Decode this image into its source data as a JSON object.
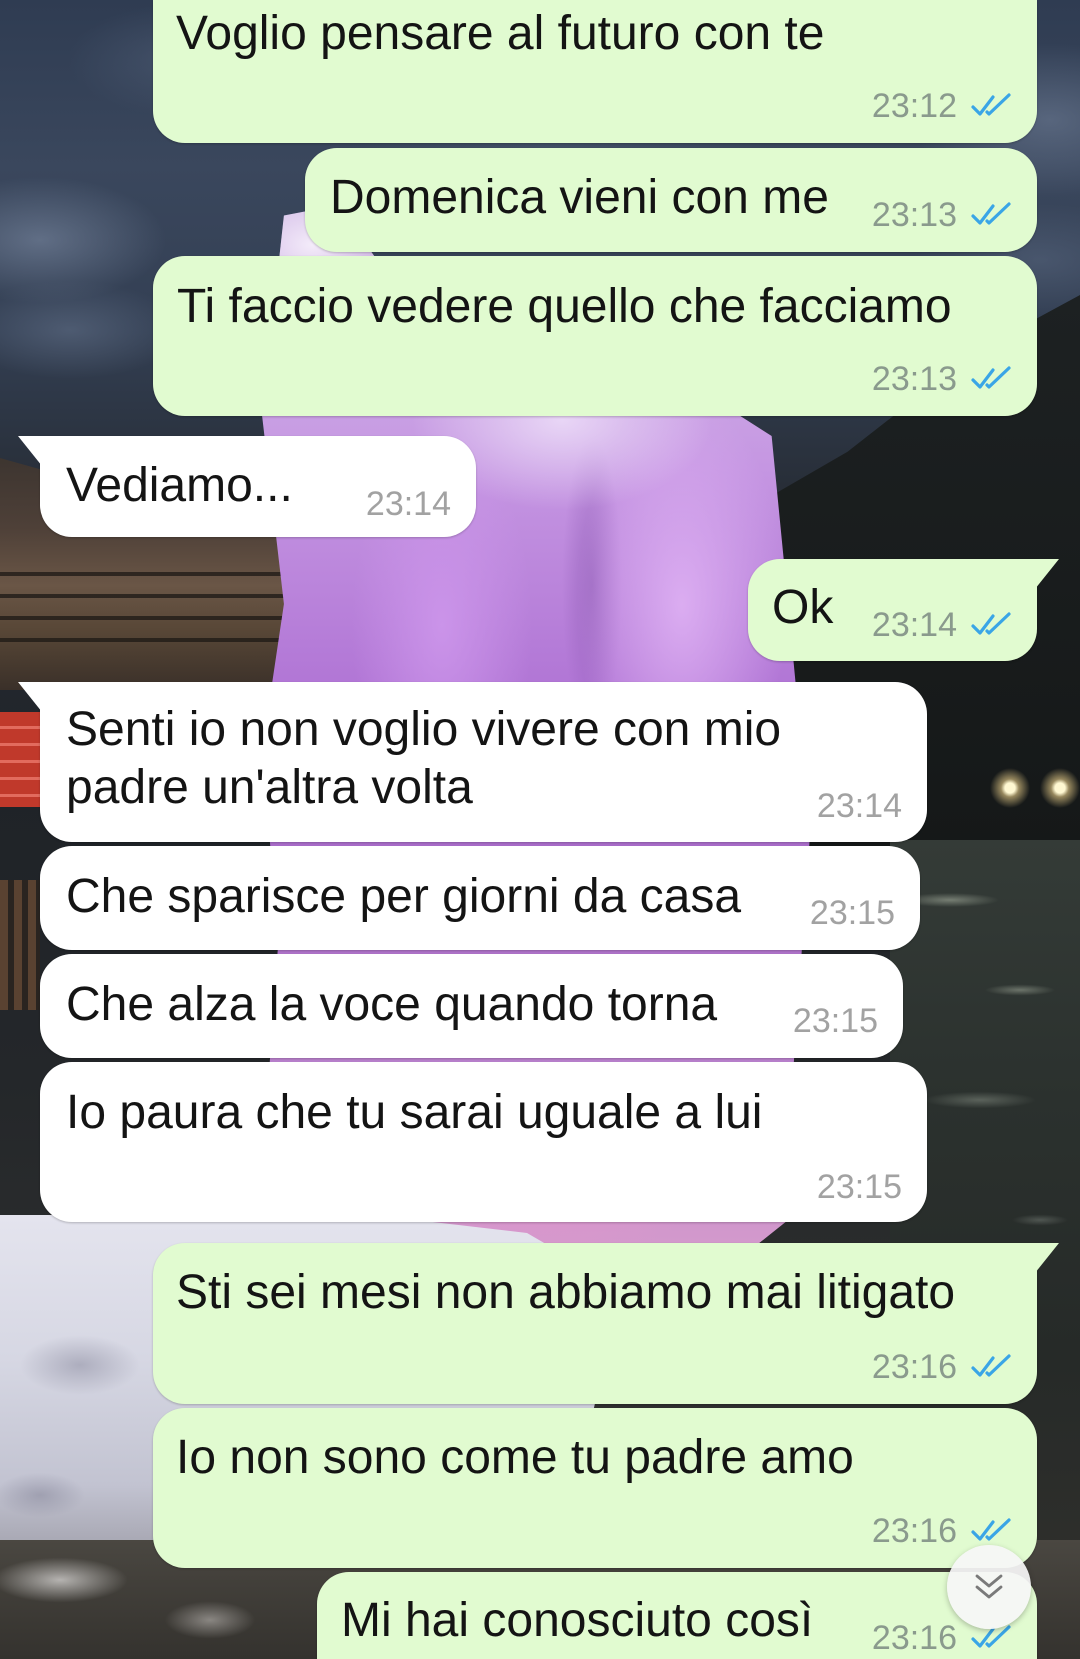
{
  "messages": [
    {
      "outgoing": true,
      "text": "Voglio pensare al futuro con te",
      "time": "23:12",
      "status_icon": "double-check-icon"
    },
    {
      "outgoing": true,
      "text": "Domenica vieni con me",
      "time": "23:13",
      "status_icon": "double-check-icon"
    },
    {
      "outgoing": true,
      "text": "Ti faccio vedere quello che facciamo",
      "time": "23:13",
      "status_icon": "double-check-icon"
    },
    {
      "outgoing": false,
      "text": "Vediamo...",
      "time": "23:14"
    },
    {
      "outgoing": true,
      "text": "Ok",
      "time": "23:14",
      "status_icon": "double-check-icon"
    },
    {
      "outgoing": false,
      "text": "Senti io non voglio vivere con mio padre un'altra volta",
      "time": "23:14"
    },
    {
      "outgoing": false,
      "text": "Che sparisce per giorni da casa",
      "time": "23:15"
    },
    {
      "outgoing": false,
      "text": "Che alza la voce quando torna",
      "time": "23:15"
    },
    {
      "outgoing": false,
      "text": "Io paura che tu sarai uguale a lui",
      "time": "23:15"
    },
    {
      "outgoing": true,
      "text": "Sti sei mesi non abbiamo mai litigato",
      "time": "23:16",
      "status_icon": "double-check-icon"
    },
    {
      "outgoing": true,
      "text": "Io non sono come tu padre amo",
      "time": "23:16",
      "status_icon": "double-check-icon"
    },
    {
      "outgoing": true,
      "text": "Mi hai conosciuto così",
      "time": "23:16",
      "status_icon": "double-check-icon"
    }
  ],
  "scroll_button": {
    "icon": "double-chevron-down-icon"
  },
  "colors": {
    "outgoing_bubble": "#e1fbd0",
    "incoming_bubble": "#ffffff",
    "read_tick": "#3aa5e6"
  }
}
